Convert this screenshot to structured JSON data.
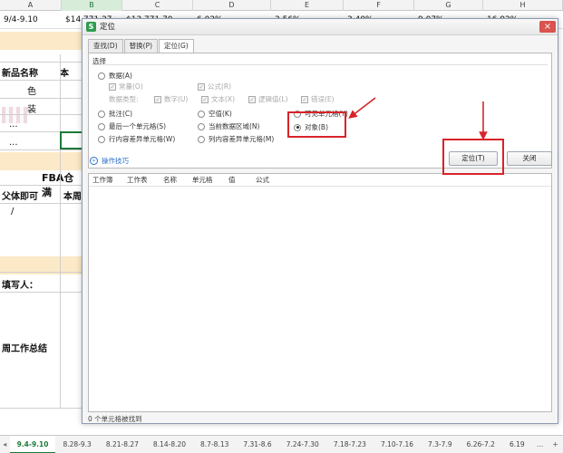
{
  "sheet": {
    "columns": [
      "A",
      "B",
      "C",
      "D",
      "E",
      "F",
      "G",
      "H"
    ],
    "active_column": "B",
    "row1": [
      "9/4-9.10",
      "$14,771.27",
      "$13,771.70",
      "6.02%",
      "3.56%",
      "3.40%",
      "9.07%",
      "16.92%"
    ],
    "left_cells": {
      "product_name_header": "新品名称",
      "col_b_header": "本",
      "color_suffix": "色",
      "package_suffix": "装",
      "ellipsis1": "...",
      "ellipsis2": "...",
      "fba_heading": "FBA仓满",
      "parent_header": "父体即可",
      "col_b_header2": "本周",
      "slash": "/",
      "filler_label": "填写人：",
      "summary_label": "周工作总结"
    },
    "sheet_tabs": [
      "9.4-9.10",
      "8.28-9.3",
      "8.21-8.27",
      "8.14-8.20",
      "8.7-8.13",
      "7.31-8.6",
      "7.24-7.30",
      "7.18-7.23",
      "7.10-7.16",
      "7.3-7.9",
      "6.26-7.2",
      "6.19"
    ],
    "tabs_more": "...",
    "tabs_add": "+"
  },
  "dialog": {
    "title": "定位",
    "app_icon_letter": "S",
    "close_symbol": "×",
    "tabs": [
      {
        "label": "查找(D)"
      },
      {
        "label": "替换(P)"
      },
      {
        "label": "定位(G)"
      }
    ],
    "group_label": "选择",
    "options": {
      "data": "数据(A)",
      "constants": "常量(O)",
      "formulas": "公式(R)",
      "data_type_label": "数据类型:",
      "numbers": "数字(U)",
      "text": "文本(X)",
      "logical": "逻辑值(L)",
      "errors": "错误(E)",
      "comments": "批注(C)",
      "blanks": "空值(K)",
      "visible_cells": "可见单元格(Y)",
      "last_cell": "最后一个单元格(S)",
      "current_region": "当前数据区域(N)",
      "objects": "对象(B)",
      "row_diff": "行内容差异单元格(W)",
      "col_diff": "列内容差异单元格(M)"
    },
    "selected_option": "objects",
    "tips": "操作技巧",
    "goto_button": "定位(T)",
    "close_button": "关闭",
    "result_columns": [
      "工作簿",
      "工作表",
      "名称",
      "单元格",
      "值",
      "公式"
    ],
    "status": "0 个单元格被找到"
  },
  "colors": {
    "accent_green": "#1d7a3a",
    "annotation_red": "#d8232a",
    "link_blue": "#2a6fc9"
  }
}
